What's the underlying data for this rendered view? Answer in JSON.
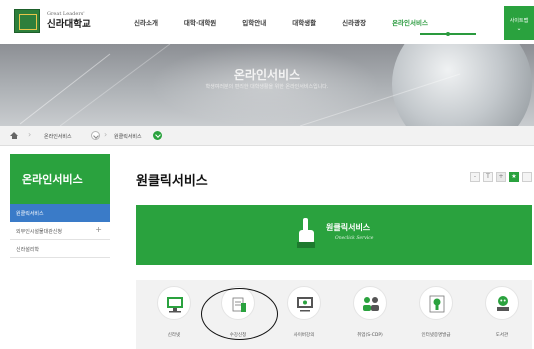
{
  "header": {
    "logo_sub": "Great Leaders'",
    "logo_name": "신라대학교",
    "menu_label": "사이트맵",
    "nav": [
      {
        "label": "신라소개",
        "active": false
      },
      {
        "label": "대학·대학원",
        "active": false
      },
      {
        "label": "입학안내",
        "active": false
      },
      {
        "label": "대학생활",
        "active": false
      },
      {
        "label": "신라광장",
        "active": false
      },
      {
        "label": "온라인서비스",
        "active": true
      }
    ]
  },
  "hero": {
    "title": "온라인서비스",
    "description": "학생여러분의 편리한 대학생활을 위한 온라인서비스입니다."
  },
  "breadcrumb": {
    "items": [
      "온라인서비스",
      "원클릭서비스"
    ]
  },
  "sidebar": {
    "title": "온라인서비스",
    "items": [
      {
        "label": "원클릭서비스",
        "active": true
      },
      {
        "label": "외부인시설물대관신청",
        "active": false,
        "expandable": true
      },
      {
        "label": "신라설리학",
        "active": false
      }
    ]
  },
  "main": {
    "title": "원클릭서비스",
    "tools": [
      "-",
      "T",
      "+",
      "★"
    ]
  },
  "banner": {
    "title": "원클릭서비스",
    "subtitle": "Oneclick Service"
  },
  "services": [
    {
      "label": "신라넷",
      "icon": "monitor-icon"
    },
    {
      "label": "수강신청",
      "icon": "course-registration-icon"
    },
    {
      "label": "사이버강의",
      "icon": "cyber-lecture-icon"
    },
    {
      "label": "취업(S-CDP)",
      "icon": "career-icon"
    },
    {
      "label": "인터넷증명발급",
      "icon": "certificate-icon"
    },
    {
      "label": "도서관",
      "icon": "library-icon"
    }
  ],
  "colors": {
    "brand_green": "#2aa23e",
    "sidebar_active_blue": "#3a7bc8",
    "highlight_outline": "#111111"
  }
}
